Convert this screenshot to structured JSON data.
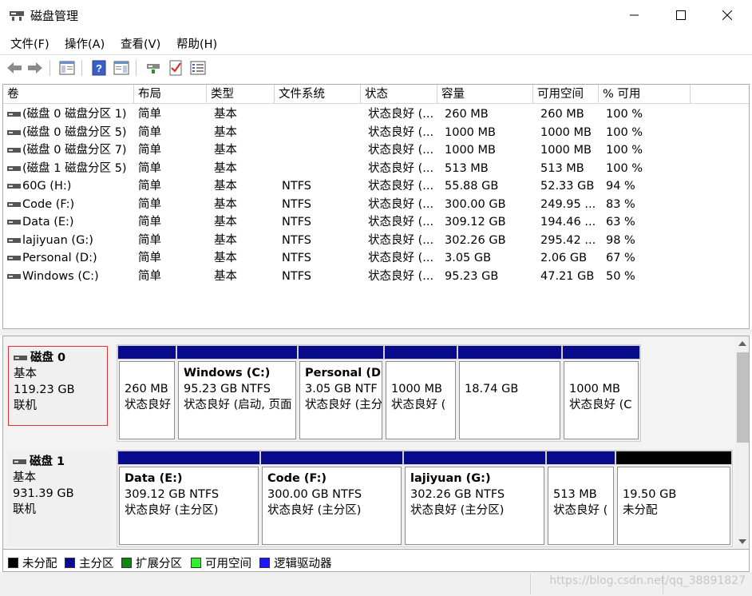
{
  "window": {
    "title": "磁盘管理",
    "icons": [
      "disk-management-icon",
      "minimize-icon",
      "maximize-icon",
      "close-icon"
    ]
  },
  "menu": [
    "文件(F)",
    "操作(A)",
    "查看(V)",
    "帮助(H)"
  ],
  "toolbar": {
    "icons": [
      "back-arrow-icon",
      "forward-arrow-icon",
      "console-tree-icon",
      "help-icon",
      "properties-icon",
      "connect-disk-icon",
      "checklist-icon",
      "details-icon"
    ]
  },
  "volume_list": {
    "columns": [
      "卷",
      "布局",
      "类型",
      "文件系统",
      "状态",
      "容量",
      "可用空间",
      "% 可用"
    ],
    "rows": [
      [
        "(磁盘 0 磁盘分区 1)",
        "简单",
        "基本",
        "",
        "状态良好 (...",
        "260 MB",
        "260 MB",
        "100 %"
      ],
      [
        "(磁盘 0 磁盘分区 5)",
        "简单",
        "基本",
        "",
        "状态良好 (...",
        "1000 MB",
        "1000 MB",
        "100 %"
      ],
      [
        "(磁盘 0 磁盘分区 7)",
        "简单",
        "基本",
        "",
        "状态良好 (...",
        "1000 MB",
        "1000 MB",
        "100 %"
      ],
      [
        "(磁盘 1 磁盘分区 5)",
        "简单",
        "基本",
        "",
        "状态良好 (...",
        "513 MB",
        "513 MB",
        "100 %"
      ],
      [
        "60G (H:)",
        "简单",
        "基本",
        "NTFS",
        "状态良好 (...",
        "55.88 GB",
        "52.33 GB",
        "94 %"
      ],
      [
        "Code (F:)",
        "简单",
        "基本",
        "NTFS",
        "状态良好 (...",
        "300.00 GB",
        "249.95 ...",
        "83 %"
      ],
      [
        "Data (E:)",
        "简单",
        "基本",
        "NTFS",
        "状态良好 (...",
        "309.12 GB",
        "194.46 ...",
        "63 %"
      ],
      [
        "lajiyuan (G:)",
        "简单",
        "基本",
        "NTFS",
        "状态良好 (...",
        "302.26 GB",
        "295.42 ...",
        "98 %"
      ],
      [
        "Personal (D:)",
        "简单",
        "基本",
        "NTFS",
        "状态良好 (...",
        "3.05 GB",
        "2.06 GB",
        "67 %"
      ],
      [
        "Windows (C:)",
        "简单",
        "基本",
        "NTFS",
        "状态良好 (...",
        "95.23 GB",
        "47.21 GB",
        "50 %"
      ]
    ]
  },
  "disks": [
    {
      "name": "磁盘 0",
      "type": "基本",
      "size": "119.23 GB",
      "status": "联机",
      "partitions": [
        {
          "name": "",
          "size": "260 MB",
          "status": "状态良好",
          "kind": "primary"
        },
        {
          "name": "Windows  (C:)",
          "size": "95.23 GB NTFS",
          "status": "状态良好 (启动, 页面",
          "kind": "primary"
        },
        {
          "name": "Personal  (D",
          "size": "3.05 GB NTF",
          "status": "状态良好 (主分",
          "kind": "primary"
        },
        {
          "name": "",
          "size": "1000 MB",
          "status": "状态良好 (",
          "kind": "primary"
        },
        {
          "name": "",
          "size": "18.74 GB",
          "status": "",
          "kind": "primary"
        },
        {
          "name": "",
          "size": "1000 MB",
          "status": "状态良好 (C",
          "kind": "primary"
        }
      ]
    },
    {
      "name": "磁盘 1",
      "type": "基本",
      "size": "931.39 GB",
      "status": "联机",
      "partitions": [
        {
          "name": "Data  (E:)",
          "size": "309.12 GB NTFS",
          "status": "状态良好 (主分区)",
          "kind": "primary"
        },
        {
          "name": "Code  (F:)",
          "size": "300.00 GB NTFS",
          "status": "状态良好 (主分区)",
          "kind": "primary"
        },
        {
          "name": "lajiyuan  (G:)",
          "size": "302.26 GB NTFS",
          "status": "状态良好 (主分区)",
          "kind": "primary"
        },
        {
          "name": "",
          "size": "513 MB",
          "status": "状态良好 (",
          "kind": "primary"
        },
        {
          "name": "",
          "size": "19.50 GB",
          "status": "未分配",
          "kind": "unallocated"
        }
      ]
    }
  ],
  "legend": [
    {
      "label": "未分配",
      "color": "#000000"
    },
    {
      "label": "主分区",
      "color": "#0a0a8c"
    },
    {
      "label": "扩展分区",
      "color": "#0a8a0a"
    },
    {
      "label": "可用空间",
      "color": "#33ee33"
    },
    {
      "label": "逻辑驱动器",
      "color": "#1a1aff"
    }
  ],
  "watermark": "https://blog.csdn.net/qq_38891827"
}
